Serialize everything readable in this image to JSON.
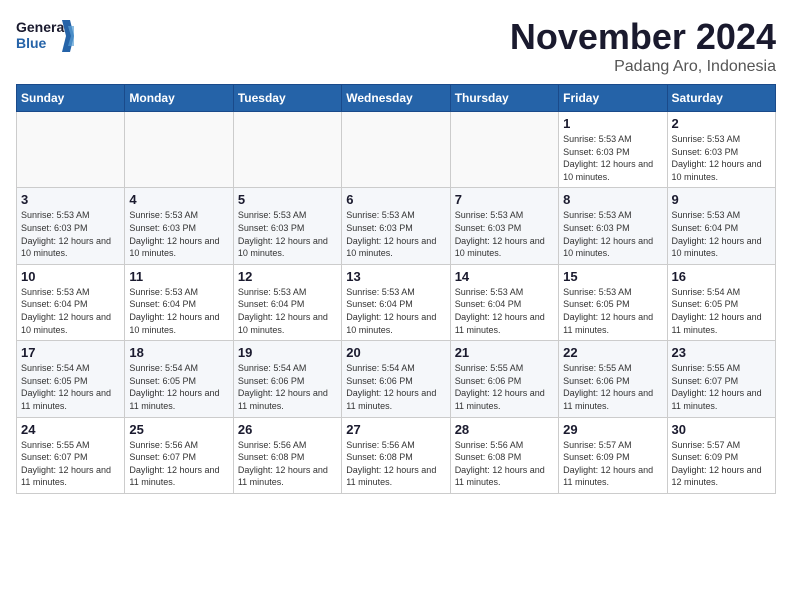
{
  "logo": {
    "line1": "General",
    "line2": "Blue"
  },
  "header": {
    "month": "November 2024",
    "location": "Padang Aro, Indonesia"
  },
  "weekdays": [
    "Sunday",
    "Monday",
    "Tuesday",
    "Wednesday",
    "Thursday",
    "Friday",
    "Saturday"
  ],
  "weeks": [
    [
      {
        "day": "",
        "info": ""
      },
      {
        "day": "",
        "info": ""
      },
      {
        "day": "",
        "info": ""
      },
      {
        "day": "",
        "info": ""
      },
      {
        "day": "",
        "info": ""
      },
      {
        "day": "1",
        "info": "Sunrise: 5:53 AM\nSunset: 6:03 PM\nDaylight: 12 hours and 10 minutes."
      },
      {
        "day": "2",
        "info": "Sunrise: 5:53 AM\nSunset: 6:03 PM\nDaylight: 12 hours and 10 minutes."
      }
    ],
    [
      {
        "day": "3",
        "info": "Sunrise: 5:53 AM\nSunset: 6:03 PM\nDaylight: 12 hours and 10 minutes."
      },
      {
        "day": "4",
        "info": "Sunrise: 5:53 AM\nSunset: 6:03 PM\nDaylight: 12 hours and 10 minutes."
      },
      {
        "day": "5",
        "info": "Sunrise: 5:53 AM\nSunset: 6:03 PM\nDaylight: 12 hours and 10 minutes."
      },
      {
        "day": "6",
        "info": "Sunrise: 5:53 AM\nSunset: 6:03 PM\nDaylight: 12 hours and 10 minutes."
      },
      {
        "day": "7",
        "info": "Sunrise: 5:53 AM\nSunset: 6:03 PM\nDaylight: 12 hours and 10 minutes."
      },
      {
        "day": "8",
        "info": "Sunrise: 5:53 AM\nSunset: 6:03 PM\nDaylight: 12 hours and 10 minutes."
      },
      {
        "day": "9",
        "info": "Sunrise: 5:53 AM\nSunset: 6:04 PM\nDaylight: 12 hours and 10 minutes."
      }
    ],
    [
      {
        "day": "10",
        "info": "Sunrise: 5:53 AM\nSunset: 6:04 PM\nDaylight: 12 hours and 10 minutes."
      },
      {
        "day": "11",
        "info": "Sunrise: 5:53 AM\nSunset: 6:04 PM\nDaylight: 12 hours and 10 minutes."
      },
      {
        "day": "12",
        "info": "Sunrise: 5:53 AM\nSunset: 6:04 PM\nDaylight: 12 hours and 10 minutes."
      },
      {
        "day": "13",
        "info": "Sunrise: 5:53 AM\nSunset: 6:04 PM\nDaylight: 12 hours and 10 minutes."
      },
      {
        "day": "14",
        "info": "Sunrise: 5:53 AM\nSunset: 6:04 PM\nDaylight: 12 hours and 11 minutes."
      },
      {
        "day": "15",
        "info": "Sunrise: 5:53 AM\nSunset: 6:05 PM\nDaylight: 12 hours and 11 minutes."
      },
      {
        "day": "16",
        "info": "Sunrise: 5:54 AM\nSunset: 6:05 PM\nDaylight: 12 hours and 11 minutes."
      }
    ],
    [
      {
        "day": "17",
        "info": "Sunrise: 5:54 AM\nSunset: 6:05 PM\nDaylight: 12 hours and 11 minutes."
      },
      {
        "day": "18",
        "info": "Sunrise: 5:54 AM\nSunset: 6:05 PM\nDaylight: 12 hours and 11 minutes."
      },
      {
        "day": "19",
        "info": "Sunrise: 5:54 AM\nSunset: 6:06 PM\nDaylight: 12 hours and 11 minutes."
      },
      {
        "day": "20",
        "info": "Sunrise: 5:54 AM\nSunset: 6:06 PM\nDaylight: 12 hours and 11 minutes."
      },
      {
        "day": "21",
        "info": "Sunrise: 5:55 AM\nSunset: 6:06 PM\nDaylight: 12 hours and 11 minutes."
      },
      {
        "day": "22",
        "info": "Sunrise: 5:55 AM\nSunset: 6:06 PM\nDaylight: 12 hours and 11 minutes."
      },
      {
        "day": "23",
        "info": "Sunrise: 5:55 AM\nSunset: 6:07 PM\nDaylight: 12 hours and 11 minutes."
      }
    ],
    [
      {
        "day": "24",
        "info": "Sunrise: 5:55 AM\nSunset: 6:07 PM\nDaylight: 12 hours and 11 minutes."
      },
      {
        "day": "25",
        "info": "Sunrise: 5:56 AM\nSunset: 6:07 PM\nDaylight: 12 hours and 11 minutes."
      },
      {
        "day": "26",
        "info": "Sunrise: 5:56 AM\nSunset: 6:08 PM\nDaylight: 12 hours and 11 minutes."
      },
      {
        "day": "27",
        "info": "Sunrise: 5:56 AM\nSunset: 6:08 PM\nDaylight: 12 hours and 11 minutes."
      },
      {
        "day": "28",
        "info": "Sunrise: 5:56 AM\nSunset: 6:08 PM\nDaylight: 12 hours and 11 minutes."
      },
      {
        "day": "29",
        "info": "Sunrise: 5:57 AM\nSunset: 6:09 PM\nDaylight: 12 hours and 11 minutes."
      },
      {
        "day": "30",
        "info": "Sunrise: 5:57 AM\nSunset: 6:09 PM\nDaylight: 12 hours and 12 minutes."
      }
    ]
  ]
}
